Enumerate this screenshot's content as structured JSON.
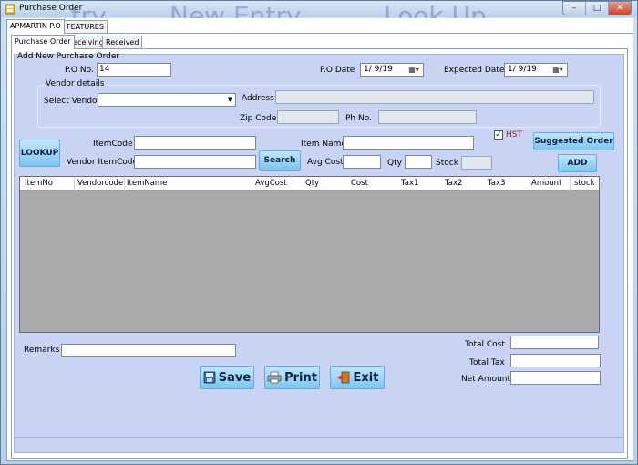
{
  "window": {
    "title": "Purchase Order",
    "ghost_menu": [
      "...try",
      "New Entry",
      "Look Up"
    ],
    "controls": {
      "minimize": "–",
      "maximize": "□",
      "close": "✕"
    }
  },
  "outer_tabs": [
    {
      "label": "APMARTIN P.O",
      "active": true
    },
    {
      "label": "FEATURES",
      "active": false
    }
  ],
  "inner_tabs": [
    {
      "label": "Purchase Order",
      "active": true
    },
    {
      "label": "Receiving",
      "active": false
    },
    {
      "label": "Received",
      "active": false
    }
  ],
  "form": {
    "section_title": "Add New Purchase Order",
    "po_no_label": "P.O No.",
    "po_no_value": "14",
    "po_date_label": "P.O Date",
    "po_date_value": "1/  9/19",
    "expected_date_label": "Expected Date",
    "expected_date_value": "1/  9/19",
    "vendor_group_title": "Vendor details",
    "select_vendor_label": "Select Vendor",
    "select_vendor_value": "",
    "address_label": "Address",
    "address_value": "",
    "zip_label": "Zip Code",
    "zip_value": "",
    "phone_label": "Ph No.",
    "phone_value": "",
    "hst_label": "HST",
    "hst_checked": true,
    "lookup_label": "LOOKUP",
    "itemcode_label": "ItemCode",
    "itemcode_value": "",
    "vendor_itemcode_label": "Vendor ItemCode",
    "vendor_itemcode_value": "",
    "search_label": "Search",
    "item_name_label": "Item Name",
    "item_name_value": "",
    "avg_cost_label": "Avg Cost",
    "avg_cost_value": "",
    "qty_label": "Qty",
    "qty_value": "",
    "stock_label": "Stock",
    "stock_value": "",
    "suggested_order_label": "Suggested Order",
    "add_label": "ADD"
  },
  "grid": {
    "columns": [
      "ItemNo",
      "Vendorcode",
      "ItemName",
      "AvgCost",
      "Qty",
      "Cost",
      "Tax1",
      "Tax2",
      "Tax3",
      "Amount",
      "stock"
    ],
    "rows": []
  },
  "totals": {
    "remarks_label": "Remarks",
    "remarks_value": "",
    "total_cost_label": "Total Cost",
    "total_cost_value": "",
    "total_tax_label": "Total Tax",
    "total_tax_value": "",
    "net_amount_label": "Net Amount",
    "net_amount_value": ""
  },
  "actions": {
    "save_label": "Save",
    "print_label": "Print",
    "exit_label": "Exit"
  },
  "icons": {
    "app": "app-window-icon",
    "save": "save-icon",
    "print": "printer-icon",
    "exit": "exit-door-icon",
    "calendar": "calendar-dropdown-icon"
  }
}
